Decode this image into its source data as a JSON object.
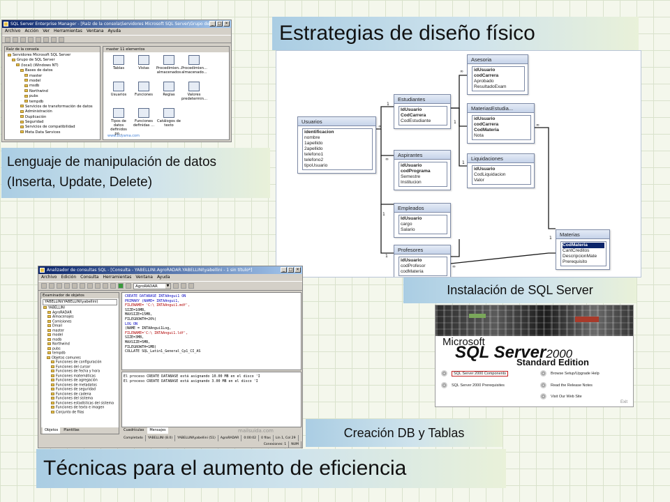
{
  "captions": {
    "estrategias": "Estrategias de diseño físico",
    "lenguaje": "Lenguaje de manipulación de datos (Inserta, Update, Delete)",
    "instalacion": "Instalación de SQL Server",
    "creacion": "Creación DB y Tablas",
    "tecnicas": "Técnicas para el aumento de eficiencia"
  },
  "enterprise_manager": {
    "title": "SQL Server Enterprise Manager - [Raíz de la consola\\Servidores Microsoft SQL Server\\Grupo de ...",
    "menu": [
      "Archivo",
      "Acción",
      "Ver",
      "Herramientas",
      "Ventana",
      "Ayuda"
    ],
    "tree_header": "Raíz de la consola",
    "tree": [
      "Servidores Microsoft SQL Server",
      "Grupo de SQL Server",
      "(local) (Windows NT)",
      "Bases de datos",
      "master",
      "model",
      "msdb",
      "Northwind",
      "pubs",
      "tempdb",
      "Servicios de transformación de datos",
      "Administración",
      "Duplicación",
      "Seguridad",
      "Servicios de compatibilidad",
      "Meta Data Services"
    ],
    "list_header": "master    11 elementos",
    "icons": [
      "Tablas",
      "Vistas",
      "Procedimien... almacenados",
      "Procedimien... almacenado...",
      "Usuarios",
      "Funciones",
      "Reglas",
      "Valores predetermin...",
      "Tipos de datos definidos po...",
      "Funciones definidas ...",
      "Catálogos de texto"
    ],
    "watermark": "www.buyama.com"
  },
  "diagram": {
    "entities": {
      "usuarios": {
        "title": "Usuarios",
        "fields": [
          "identificacion",
          "nombre",
          "1apellido",
          "2apellido",
          "telefono1",
          "telefono2",
          "tipoUsuario"
        ]
      },
      "estudiantes": {
        "title": "Estudiantes",
        "fields": [
          "IdUsuario",
          "CodCarrera",
          "CodEstudiante"
        ]
      },
      "aspirantes": {
        "title": "Aspirantes",
        "fields": [
          "idUsuario",
          "codPrograma",
          "Semestre",
          "Institucion"
        ]
      },
      "empleados": {
        "title": "Empleados",
        "fields": [
          "IdUsuario",
          "cargo",
          "Salario"
        ]
      },
      "profesores": {
        "title": "Profesores",
        "fields": [
          "idUsuario",
          "codProfesor",
          "codMateria"
        ]
      },
      "asesoria": {
        "title": "Asesoria",
        "fields": [
          "idUsuario",
          "codCarrera",
          "Aprobado",
          "ResultadoExam"
        ]
      },
      "materiasestudia": {
        "title": "MateriasEstudia...",
        "fields": [
          "idUsuario",
          "codCarrera",
          "CodMateria",
          "Nota"
        ]
      },
      "liquidaciones": {
        "title": "Liquidaciones",
        "fields": [
          "idUsuario",
          "CodLiquidacion",
          "Valor"
        ]
      },
      "materias": {
        "title": "Materias",
        "fields": [
          "CodMateria",
          "CantCreditos",
          "DescripcionMate",
          "Prerequisito"
        ]
      }
    }
  },
  "query_analyzer": {
    "title": "Analizador de consultas SQL - [Consulta - YABELLINI.AgroRADAR.YABELLINI\\yabellini - 1 sin título*]",
    "menu": [
      "Archivo",
      "Edición",
      "Consulta",
      "Herramientas",
      "Ventana",
      "Ayuda"
    ],
    "database_select": "AgroRADAR",
    "browser_title": "Examinador de objetos",
    "browser_server": "YABELLINI(YABELLINI\\yabellini)",
    "tree": [
      "YABELLINI",
      "AgroRADAR",
      "Almacenajes",
      "Comisiones",
      "Dmail",
      "master",
      "model",
      "msdb",
      "Northwind",
      "pubs",
      "tempdb",
      "Objetos comunes",
      "Funciones de configuración",
      "Funciones del cursor",
      "Funciones de fecha y hora",
      "Funciones matemáticas",
      "Funciones de agregación",
      "Funciones de metadatos",
      "Funciones de seguridad",
      "Funciones de cadena",
      "Funciones del sistema",
      "Funciones estadísticas del sistema",
      "Funciones de texto e imagen",
      "Conjunto de filas"
    ],
    "browser_tabs": [
      "Objetos",
      "Plantillas"
    ],
    "code": [
      "CREATE DATABASE INTAAngui1 ON",
      "PRIMARY (NAME= INTAAngui1,",
      "FILENAME= 'C:\\ INTAAngui1.mdf',",
      "SIZE=10MB,",
      "MAXSIZE=15MB,",
      "FILEGROWTH=20%)",
      "LOG ON",
      "(NAME = INTAAngui1Log,",
      "FILENAME='C:\\ INTAAngui1.ldf',",
      "SIZE=3MB,",
      "MAXSIZE=5MB,",
      "FILEGROWTH=1MB)",
      "COLLATE SQL_Latin1_General_Cp1_CI_AS"
    ],
    "messages": [
      "El proceso CREATE DATABASE está asignando 10.00 MB en el disco 'I",
      "El proceso CREATE DATABASE está asignando 3.00 MB en el disco 'I"
    ],
    "result_tabs": [
      "Cuadrículas",
      "Mensajes"
    ],
    "status": [
      "Completado",
      "YABELLINI (8.0)",
      "YABELLINI\\yabellini (51)",
      "AgroRADAR",
      "0:00:02",
      "0 filas",
      "Lín 1, Col 29"
    ],
    "status_extra": [
      "Conexiones: 1",
      "NUM"
    ],
    "watermark": "mailsuida.com"
  },
  "splash": {
    "brand_ms": "Microsoft",
    "brand_product": "SQL Server",
    "brand_version": "2000",
    "edition": "Standard Edition",
    "options_left": [
      "SQL Server 2000 Components",
      "SQL Server 2000 Prerequisites"
    ],
    "options_right": [
      "Browse Setup/Upgrade Help",
      "Read the Release Notes",
      "Visit Our Web Site"
    ],
    "exit": "Exit"
  }
}
